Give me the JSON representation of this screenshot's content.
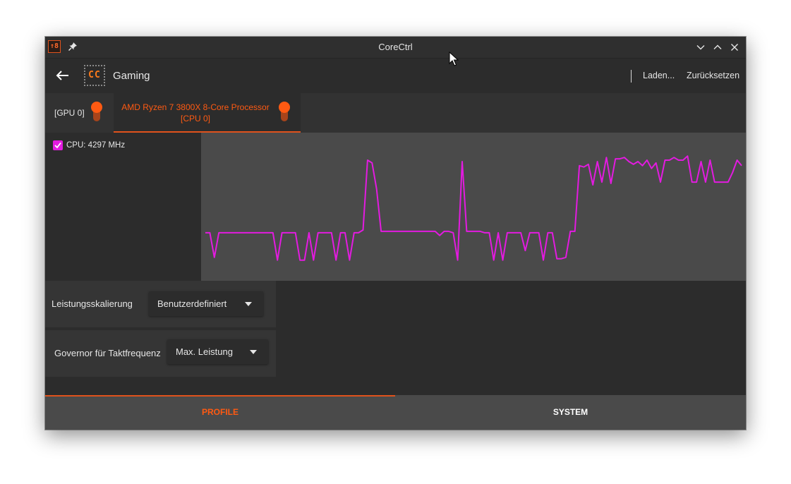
{
  "window": {
    "title": "CoreCtrl",
    "app_icon_text": "↑8"
  },
  "toolbar": {
    "profile_name": "Gaming",
    "logo_text": "CC",
    "load_label": "Laden...",
    "reset_label": "Zurücksetzen"
  },
  "tabs": [
    {
      "label": "[GPU 0]",
      "active": false,
      "enabled": true
    },
    {
      "label_line1": "AMD Ryzen 7 3800X 8-Core Processor",
      "label_line2": "[CPU 0]",
      "active": true,
      "enabled": true
    }
  ],
  "sensor": {
    "label": "CPU: 4297 MHz",
    "checked": true,
    "color": "#e31be0"
  },
  "graph_data": {
    "series_color": "#e31be0",
    "values": [
      0.31,
      0.31,
      0.13,
      0.31,
      0.31,
      0.31,
      0.31,
      0.31,
      0.31,
      0.31,
      0.31,
      0.31,
      0.31,
      0.31,
      0.31,
      0.31,
      0.11,
      0.31,
      0.31,
      0.31,
      0.31,
      0.11,
      0.11,
      0.31,
      0.11,
      0.31,
      0.31,
      0.31,
      0.31,
      0.11,
      0.31,
      0.31,
      0.11,
      0.31,
      0.31,
      0.33,
      0.84,
      0.82,
      0.63,
      0.32,
      0.32,
      0.32,
      0.32,
      0.32,
      0.32,
      0.32,
      0.32,
      0.32,
      0.32,
      0.32,
      0.32,
      0.32,
      0.29,
      0.32,
      0.32,
      0.31,
      0.11,
      0.83,
      0.32,
      0.32,
      0.32,
      0.32,
      0.31,
      0.31,
      0.11,
      0.31,
      0.11,
      0.31,
      0.31,
      0.31,
      0.31,
      0.18,
      0.31,
      0.31,
      0.31,
      0.11,
      0.31,
      0.31,
      0.12,
      0.12,
      0.13,
      0.32,
      0.32,
      0.8,
      0.79,
      0.81,
      0.66,
      0.83,
      0.68,
      0.86,
      0.67,
      0.85,
      0.85,
      0.86,
      0.83,
      0.81,
      0.83,
      0.8,
      0.84,
      0.78,
      0.82,
      0.68,
      0.84,
      0.84,
      0.86,
      0.84,
      0.84,
      0.87,
      0.68,
      0.68,
      0.83,
      0.68,
      0.84,
      0.68,
      0.68,
      0.68,
      0.68,
      0.75,
      0.84,
      0.8
    ]
  },
  "settings": {
    "performance_scaling": {
      "label": "Leistungsskalierung",
      "value": "Benutzerdefiniert"
    },
    "governor": {
      "label": "Governor für Taktfrequenz",
      "value": "Max. Leistung"
    }
  },
  "bottom_tabs": [
    {
      "label": "PROFILE",
      "active": true
    },
    {
      "label": "SYSTEM",
      "active": false
    }
  ],
  "colors": {
    "accent": "#e0521c",
    "toggle_on": "#ff5a12",
    "graph_line": "#e31be0",
    "background": "#2c2c2c"
  }
}
